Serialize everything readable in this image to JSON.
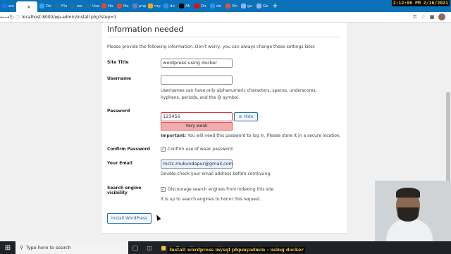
{
  "browser": {
    "tabs": [
      {
        "label": "wo",
        "color": "#1a73e8"
      },
      {
        "label": "",
        "color": "#ffffff",
        "active": true
      },
      {
        "label": "Do",
        "color": "#34a8eb"
      },
      {
        "label": "Plu",
        "color": "#21759b"
      },
      {
        "label": "wo",
        "color": "#21759b"
      },
      {
        "label": "Use",
        "color": "#21759b"
      },
      {
        "label": "Ho",
        "color": "#ea4335"
      },
      {
        "label": "Ho",
        "color": "#ea4335"
      },
      {
        "label": "php",
        "color": "#6c7eb7"
      },
      {
        "label": "my:",
        "color": "#f4a623"
      },
      {
        "label": "do",
        "color": "#2496ed"
      },
      {
        "label": "Ali",
        "color": "#000000"
      },
      {
        "label": "Do",
        "color": "#ff0000"
      },
      {
        "label": "do",
        "color": "#2496ed"
      },
      {
        "label": "On",
        "color": "#e05243"
      },
      {
        "label": "go",
        "color": "#8ab4f8"
      },
      {
        "label": "Go",
        "color": "#8ab4f8"
      }
    ],
    "new_tab_label": "+",
    "url": "localhost:8000/wp-admin/install.php?step=1",
    "clock_text": "2:12:06 PM 2/16/2021"
  },
  "page": {
    "heading": "Information needed",
    "intro": "Please provide the following information. Don’t worry, you can always change these settings later.",
    "site_title": {
      "label": "Site Title",
      "value": "wordpress using docker"
    },
    "username": {
      "label": "Username",
      "value": "",
      "hint": "Usernames can have only alphanumeric characters, spaces, underscores, hyphens, periods, and the @ symbol."
    },
    "password": {
      "label": "Password",
      "value": "123456",
      "hide_label": "Hide",
      "strength": "Very weak",
      "important_prefix": "Important:",
      "important_text": " You will need this password to log in. Please store it in a secure location."
    },
    "confirm_password": {
      "label": "Confirm Password",
      "checkbox_label": "Confirm use of weak password",
      "checked": true
    },
    "email": {
      "label": "Your Email",
      "value": "mctc.mukundapur@gmail.com",
      "hint": "Double-check your email address before continuing."
    },
    "search_engine": {
      "label_line1": "Search engine",
      "label_line2": "visibility",
      "checkbox_label": "Discourage search engines from indexing this site",
      "checked": true,
      "hint": "It is up to search engines to honor this request."
    },
    "install_button": "Install WordPress"
  },
  "taskbar": {
    "search_placeholder": "Type here to search",
    "caption": "Install wordpress mysql phpmyadmin - using docker"
  }
}
